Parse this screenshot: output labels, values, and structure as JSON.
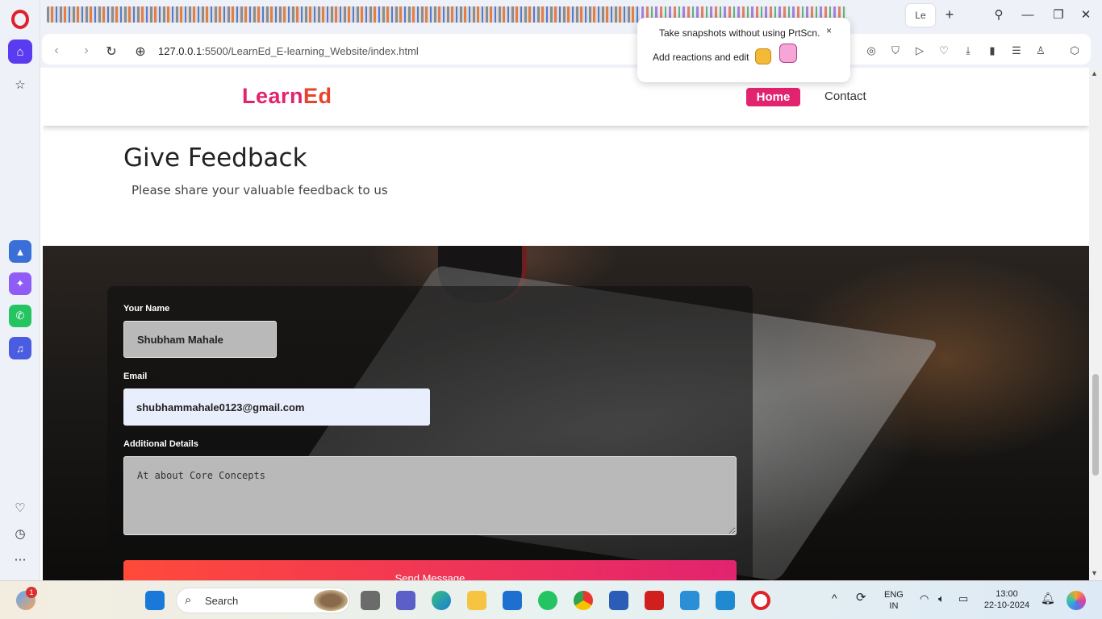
{
  "browser": {
    "url_host": "127.0.0.1",
    "url_rest": ":5500/LearnEd_E-learning_Website/index.html",
    "active_tab_label": "Le"
  },
  "popup": {
    "line1": "Take snapshots without using PrtScn.",
    "line2": "Add reactions and edit",
    "close": "×"
  },
  "site": {
    "logo_main": "Learn",
    "logo_accent": "Ed",
    "nav": {
      "home": "Home",
      "contact": "Contact"
    },
    "feedback_title": "Give Feedback",
    "feedback_subtitle": "Please share your valuable feedback to us"
  },
  "form": {
    "name_label": "Your Name",
    "name_value": "Shubham Mahale",
    "email_label": "Email",
    "email_value": "shubhammahale0123@gmail.com",
    "details_label": "Additional Details",
    "details_value": "At about Core Concepts",
    "send_label": "Send Message"
  },
  "taskbar": {
    "search_placeholder": "Search",
    "badge_count": "1",
    "lang_line1": "ENG",
    "lang_line2": "IN",
    "time": "13:00",
    "date": "22-10-2024"
  },
  "colors": {
    "brand_pink": "#e2236f",
    "opera_red": "#e0202a",
    "opera_home": "#5b3bf0"
  }
}
